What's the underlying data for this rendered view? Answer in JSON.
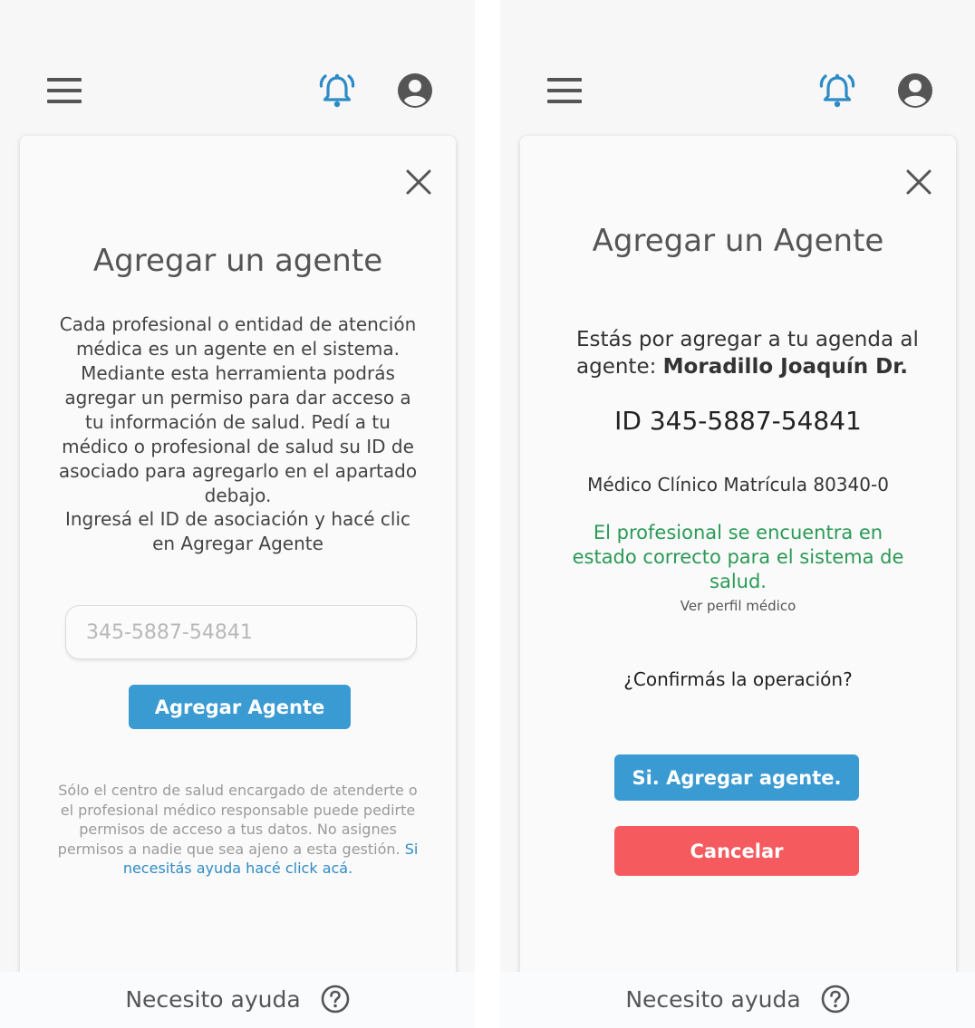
{
  "colors": {
    "accent": "#3a9ad2",
    "danger": "#f45a5e",
    "success": "#2a9a55",
    "link": "#2e8bc5"
  },
  "icons": {
    "menu": "hamburger-icon",
    "notifications": "bell-ringing-icon",
    "profile": "user-circle-icon",
    "close": "close-icon",
    "help": "question-circle-icon"
  },
  "left": {
    "title": "Agregar un agente",
    "description": "Cada profesional o entidad de atención médica es un agente en el sistema. Mediante esta herramienta podrás agregar un permiso para dar acceso a tu información de salud. Pedí a tu médico o profesional de salud su ID de asociado para agregarlo en el apartado debajo.",
    "instruction": "Ingresá el ID de asociación y hacé clic en Agregar Agente",
    "input_placeholder": "345-5887-54841",
    "add_button": "Agregar Agente",
    "note": "Sólo el centro de salud encargado de atenderte o el profesional médico responsable puede pedirte permisos de acceso a tus datos. No asignes permisos a nadie que sea ajeno a esta gestión.",
    "help_link": "Si necesitás ayuda hacé click acá."
  },
  "right": {
    "title": "Agregar un Agente",
    "confirm_intro": "Estás por agregar a tu agenda al agente: ",
    "agent_name": "Moradillo Joaquín Dr.",
    "agent_id": "ID 345-5887-54841",
    "specialty": "Médico Clínico Matrícula 80340-0",
    "status": "El profesional se encuentra en estado correcto para el sistema de salud.",
    "profile_link": "Ver perfil médico",
    "question": "¿Confirmás la operación?",
    "confirm_button": "Si. Agregar agente.",
    "cancel_button": "Cancelar"
  },
  "footer": {
    "help_label": "Necesito ayuda"
  }
}
